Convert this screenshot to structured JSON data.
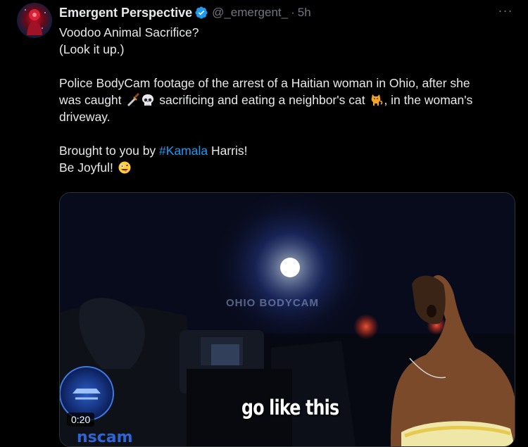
{
  "author": {
    "display_name": "Emergent Perspective",
    "handle": "@_emergent_",
    "separator": "·",
    "time": "5h",
    "verified": true,
    "verified_color": "#1d9bf0"
  },
  "menu": {
    "more_label": "···"
  },
  "tweet": {
    "line1": "Voodoo Animal Sacrifice?",
    "line2": "(Look it up.)",
    "line3": "Police BodyCam footage of the arrest of a Haitian woman in Ohio, after she",
    "line4_before": "was caught",
    "line4_after": "sacrificing and eating a neighbor's cat",
    "line4_end": ", in the woman's",
    "line5": "driveway.",
    "line6_before": "Brought to you by ",
    "hashtag": "#Kamala",
    "line6_after": " Harris!",
    "line7": "Be Joyful!",
    "emojis": [
      "dagger-emoji",
      "skull-emoji",
      "cat-emoji",
      "zany-face-emoji"
    ]
  },
  "media": {
    "watermark": "OHIO BODYCAM",
    "caption": "go like this",
    "duration": "0:20",
    "badge_text": "nscam",
    "play_icon": "video-icon"
  },
  "colors": {
    "background": "#000000",
    "text": "#e7e9ea",
    "secondary": "#71767b",
    "link": "#1d9bf0",
    "border": "#2f3336"
  }
}
